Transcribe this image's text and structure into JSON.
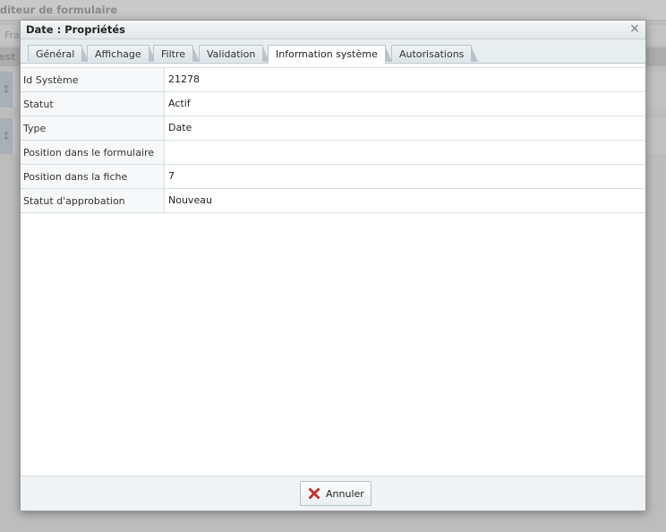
{
  "background": {
    "app_title": "Éditeur de formulaire",
    "toolbar_text": "Fra",
    "band_text": "est"
  },
  "dialog": {
    "title": "Date : Propriétés",
    "close_glyph": "×",
    "tabs": [
      {
        "label": "Général",
        "active": false
      },
      {
        "label": "Affichage",
        "active": false
      },
      {
        "label": "Filtre",
        "active": false
      },
      {
        "label": "Validation",
        "active": false
      },
      {
        "label": "Information système",
        "active": true
      },
      {
        "label": "Autorisations",
        "active": false
      }
    ],
    "properties": [
      {
        "key": "Id Système",
        "value": "21278"
      },
      {
        "key": "Statut",
        "value": "Actif"
      },
      {
        "key": "Type",
        "value": "Date"
      },
      {
        "key": "Position dans le formulaire",
        "value": ""
      },
      {
        "key": "Position dans la fiche",
        "value": "7"
      },
      {
        "key": "Statut d'approbation",
        "value": "Nouveau"
      }
    ],
    "footer": {
      "cancel_label": "Annuler",
      "cancel_icon": "red-x-icon"
    }
  },
  "colors": {
    "cancel_icon_red": "#d8322c"
  }
}
